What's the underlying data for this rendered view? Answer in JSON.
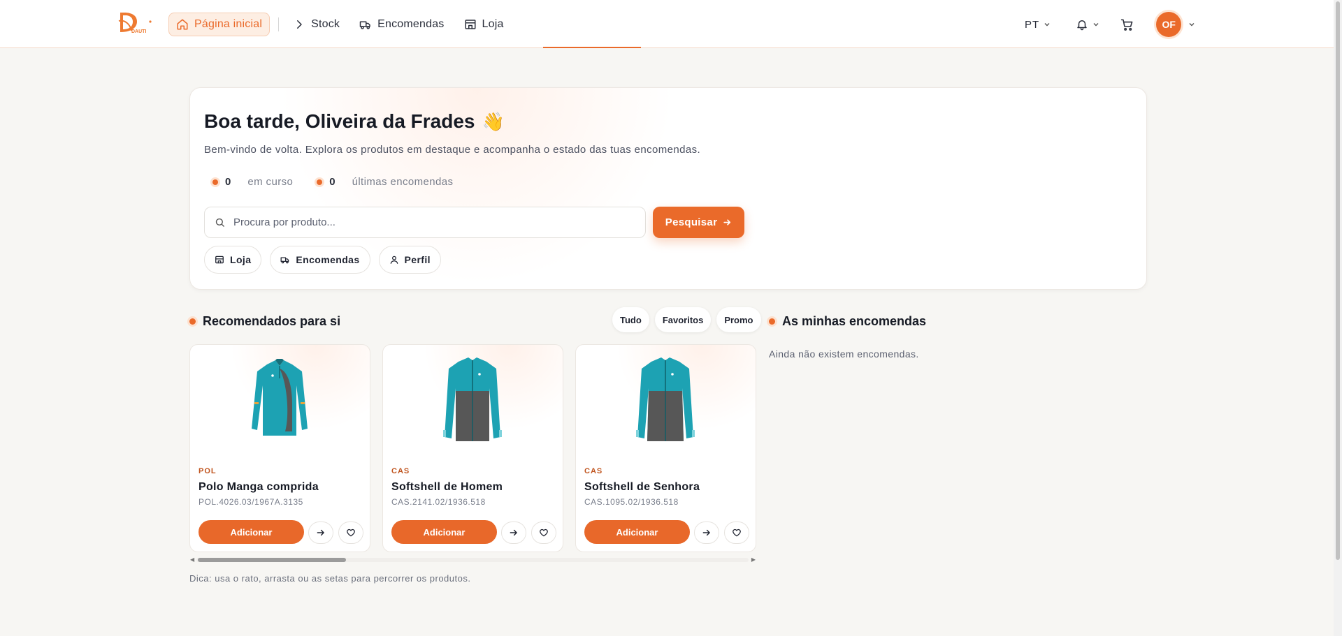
{
  "header": {
    "logo_alt": "DAUTI",
    "nav": [
      {
        "label": "Página inicial",
        "icon": "home-icon",
        "active": true
      },
      {
        "label": "Stock",
        "icon": "chevron-right-icon",
        "active": false
      },
      {
        "label": "Encomendas",
        "icon": "truck-icon",
        "active": false
      },
      {
        "label": "Loja",
        "icon": "store-icon",
        "active": false
      }
    ],
    "language": "PT",
    "avatar_initials": "OF",
    "accent_color": "#ea6a2a"
  },
  "hero": {
    "greeting": "Boa tarde, Oliveira da Frades",
    "wave_emoji": "👋",
    "subtitle": "Bem-vindo de volta. Explora os produtos em destaque e acompanha o estado das tuas encomendas.",
    "stats": [
      {
        "value": "0",
        "label": "em curso"
      },
      {
        "value": "0",
        "label": "últimas encomendas"
      }
    ],
    "search": {
      "placeholder": "Procura por produto...",
      "value": "",
      "button_label": "Pesquisar"
    },
    "quick_links": [
      {
        "label": "Loja",
        "icon": "store-icon"
      },
      {
        "label": "Encomendas",
        "icon": "truck-icon"
      },
      {
        "label": "Perfil",
        "icon": "user-icon"
      }
    ]
  },
  "recommended": {
    "title": "Recomendados para si",
    "filters": [
      "Tudo",
      "Favoritos",
      "Promo"
    ],
    "products": [
      {
        "category": "POL",
        "name": "Polo Manga comprida",
        "ref": "POL.4026.03/1967A.3135",
        "add_label": "Adicionar"
      },
      {
        "category": "CAS",
        "name": "Softshell de Homem",
        "ref": "CAS.2141.02/1936.518",
        "add_label": "Adicionar"
      },
      {
        "category": "CAS",
        "name": "Softshell de Senhora",
        "ref": "CAS.1095.02/1936.518",
        "add_label": "Adicionar"
      }
    ],
    "hint": "Dica: usa o rato, arrasta ou as setas para percorrer os produtos."
  },
  "orders": {
    "title": "As minhas encomendas",
    "empty_text": "Ainda não existem encomendas."
  }
}
